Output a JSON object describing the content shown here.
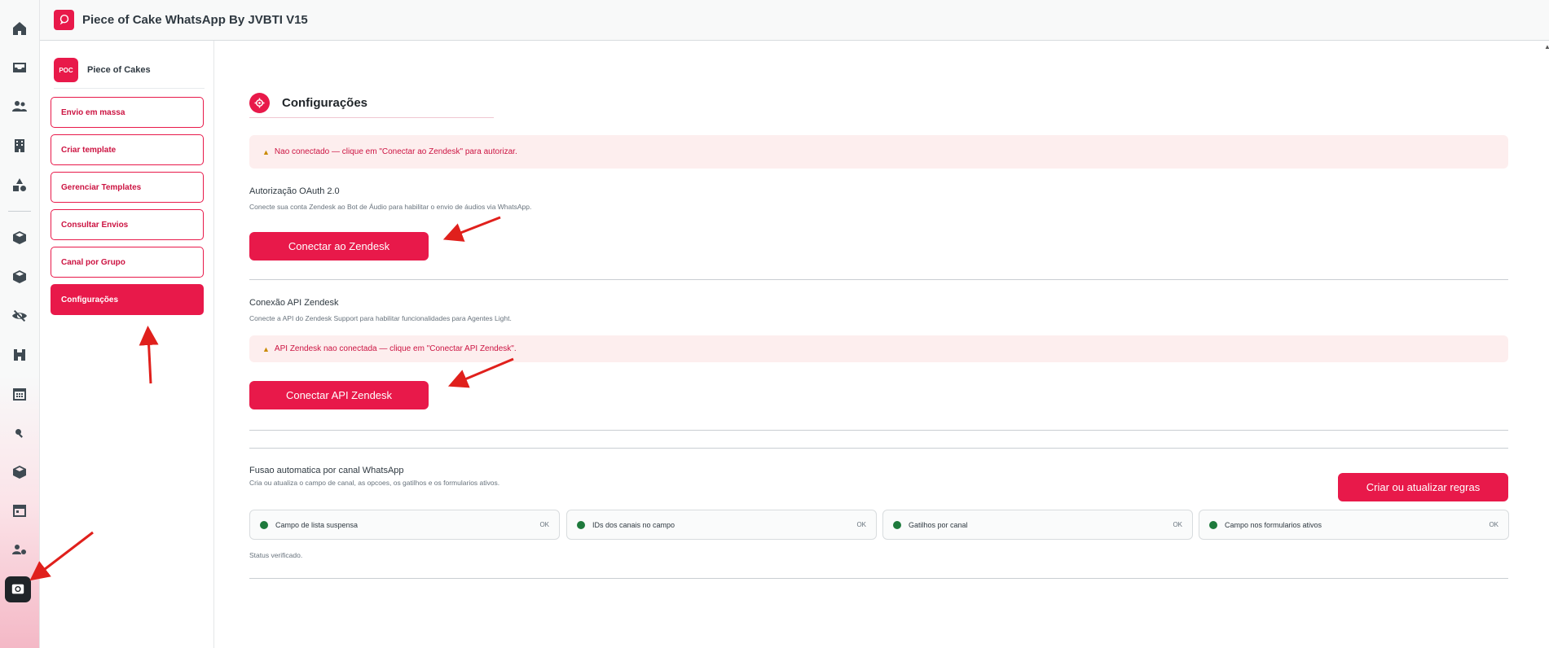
{
  "header": {
    "title": "Piece of Cake WhatsApp By JVBTI V15",
    "logo_text": "pie"
  },
  "sidebar": {
    "brand": {
      "badge": "POC",
      "name": "Piece of Cakes"
    },
    "items": [
      {
        "label": "Envio em massa",
        "active": false
      },
      {
        "label": "Criar template",
        "active": false
      },
      {
        "label": "Gerenciar Templates",
        "active": false
      },
      {
        "label": "Consultar Envios",
        "active": false
      },
      {
        "label": "Canal por Grupo",
        "active": false
      },
      {
        "label": "Configurações",
        "active": true
      }
    ]
  },
  "rail": {
    "icons": [
      "home-icon",
      "inbox-icon",
      "users-icon",
      "building-icon",
      "shapes-icon",
      "box-icon",
      "box-icon",
      "eye-off-icon",
      "binoculars-icon",
      "calendar-grid-icon",
      "search-icon",
      "box-icon",
      "calendar-icon",
      "user-gear-icon",
      "whatsapp-app-icon"
    ]
  },
  "main": {
    "title": "Configurações",
    "alert_oauth": "Nao conectado — clique em \"Conectar ao Zendesk\" para autorizar.",
    "oauth": {
      "title": "Autorização OAuth 2.0",
      "desc": "Conecte sua conta Zendesk ao Bot de Áudio para habilitar o envio de áudios via WhatsApp.",
      "button": "Conectar ao Zendesk"
    },
    "api": {
      "title": "Conexão API Zendesk",
      "desc": "Conecte a API do Zendesk Support para habilitar funcionalidades para Agentes Light.",
      "alert": "API Zendesk nao conectada — clique em \"Conectar API Zendesk\".",
      "button": "Conectar API Zendesk"
    },
    "fusao": {
      "title": "Fusao automatica por canal WhatsApp",
      "desc": "Cria ou atualiza o campo de canal, as opcoes, os gatilhos e os formularios ativos.",
      "button": "Criar ou atualizar regras",
      "checks": [
        {
          "label": "Campo de lista suspensa",
          "status": "OK"
        },
        {
          "label": "IDs dos canais no campo",
          "status": "OK"
        },
        {
          "label": "Gatilhos por canal",
          "status": "OK"
        },
        {
          "label": "Campo nos formularios ativos",
          "status": "OK"
        }
      ],
      "status_text": "Status verificado."
    }
  },
  "colors": {
    "accent": "#e8194a",
    "alert_bg": "#fdeeee",
    "ok_dot": "#1e7a3c",
    "annotation_arrow": "#e0201c"
  }
}
